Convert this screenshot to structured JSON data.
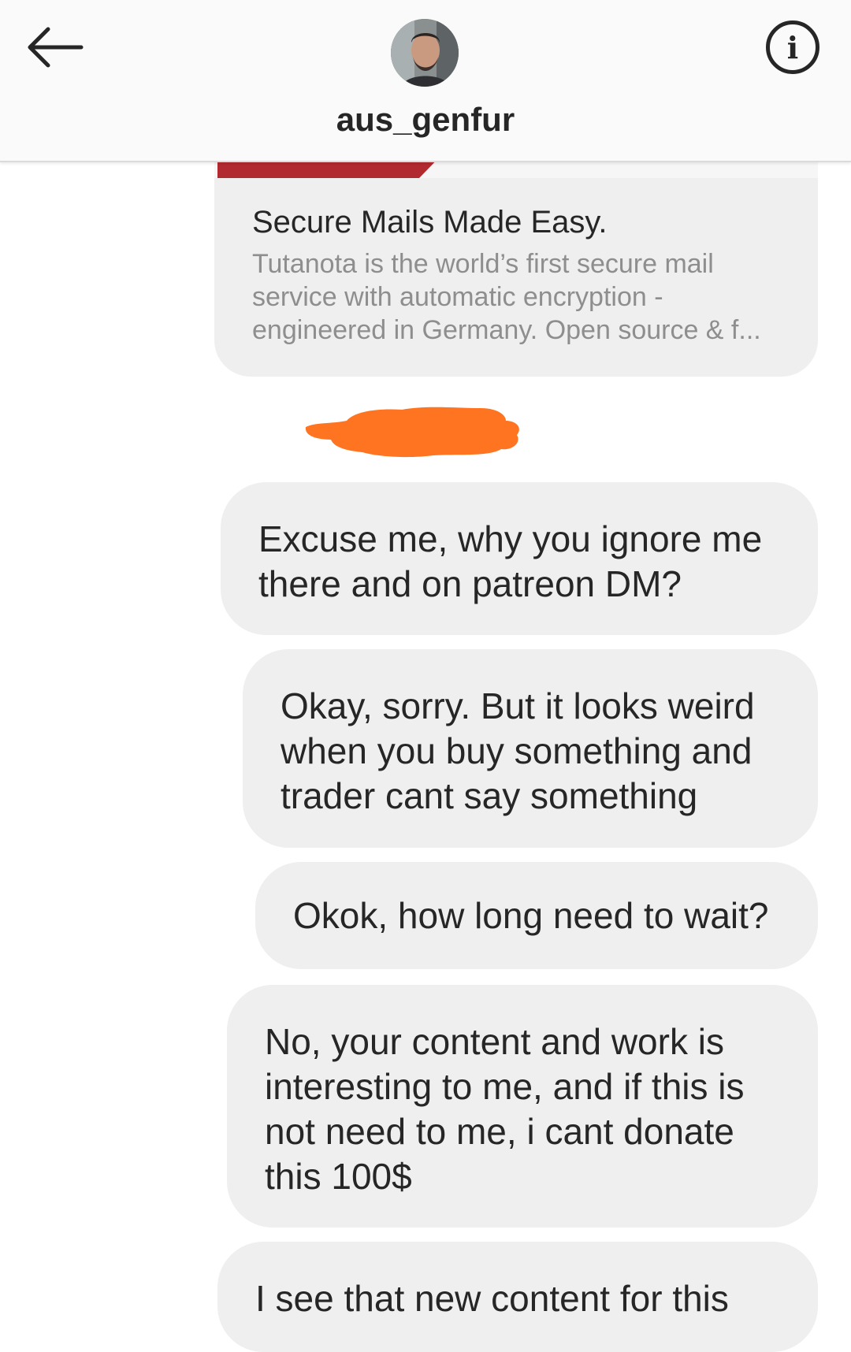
{
  "header": {
    "username": "aus_genfur",
    "back_icon": "arrow-left-icon",
    "info_icon": "info-icon"
  },
  "link_card": {
    "title": "Secure Mails Made Easy.",
    "description": "Tutanota is the world’s first secure mail service with automatic encryption - engineered in Germany. Open source & f..."
  },
  "messages": [
    {
      "text": "Excuse me, why you ignore me there and on patreon DM?"
    },
    {
      "text": "Okay, sorry. But it looks weird when you buy something and trader cant say something"
    },
    {
      "text": "Okok, how long need to wait?"
    },
    {
      "text": "No, your content and work is interesting to me, and if this is not need to me, i cant donate this 100$"
    },
    {
      "text": "I see that new content for this"
    }
  ],
  "colors": {
    "bubble_bg": "#efefef",
    "redaction": "#ff7420",
    "card_stripe": "#b02a2f"
  }
}
